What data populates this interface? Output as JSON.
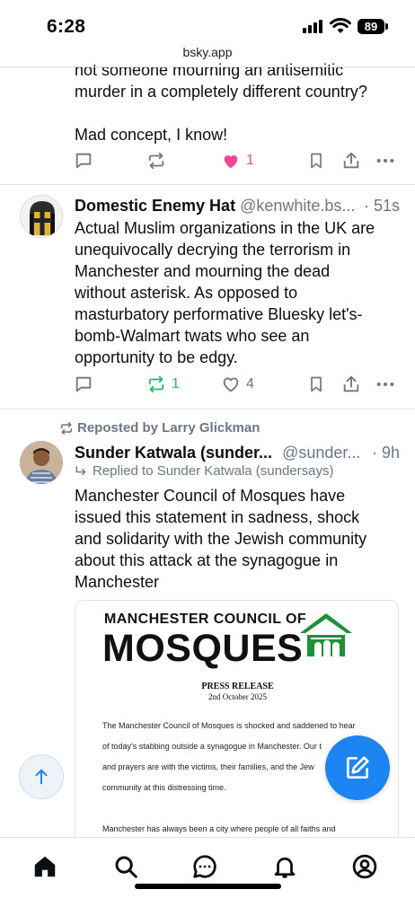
{
  "status_bar": {
    "time": "6:28",
    "battery": "89"
  },
  "browser": {
    "url": "bsky.app"
  },
  "post1": {
    "text_lines": [
      "not someone mourning an antisemitic",
      "murder in a completely different country?",
      "",
      "Mad concept, I know!"
    ],
    "like_count": "1",
    "colors": {
      "liked": "#ec4899"
    }
  },
  "post2": {
    "display_name": "Domestic Enemy Hat",
    "handle": "@kenwhite.bs...",
    "time": "· 51s",
    "text_lines": [
      "Actual Muslim organizations in the UK are",
      "unequivocally decrying the terrorism in",
      "Manchester and mourning the dead",
      "without asterisk.  As opposed to",
      "masturbatory performative Bluesky let's-",
      "bomb-Walmart twats who see an",
      "opportunity to be edgy."
    ],
    "repost_count": "1",
    "like_count": "4",
    "colors": {
      "reposted": "#20bc63"
    }
  },
  "post3": {
    "reposted_by": "Reposted by Larry Glickman",
    "display_name": "Sunder Katwala (sunder...",
    "handle": "@sunder...",
    "time": "· 9h",
    "replied_to": "Replied to Sunder Katwala (sundersays)",
    "text_lines": [
      "Manchester Council of Mosques have",
      "issued this statement in sadness, shock",
      "and solidarity with the Jewish community",
      "about this attack at the synagogue in",
      "Manchester"
    ],
    "embed": {
      "org_line1": "MANCHESTER COUNCIL OF",
      "org_line2": "MOSQUES",
      "title": "PRESS RELEASE",
      "date": "2nd October 2025",
      "body_lines": [
        "The Manchester Council of Mosques is shocked and saddened to hear",
        "of today's stabbing outside a synagogue in Manchester. Our t",
        "and prayers are with the victims, their families, and the Jew",
        "community at this distressing time.",
        "",
        "Manchester has always been a city where people of all faiths and"
      ],
      "colors": {
        "logo_green": "#1f8f3a"
      }
    }
  },
  "icons": {
    "reply": "speech-bubble-icon",
    "repost": "repost-arrows-icon",
    "like": "heart-icon",
    "bookmark": "bookmark-icon",
    "share": "share-icon",
    "more": "more-dots-icon",
    "scroll_top": "arrow-up-icon",
    "compose": "compose-pencil-icon",
    "nav": [
      "home-icon",
      "search-icon",
      "chat-icon",
      "bell-icon",
      "profile-icon"
    ]
  },
  "colors": {
    "accent": "#1d84f4",
    "muted": "#6b7785",
    "divider": "#dfe3e8"
  }
}
